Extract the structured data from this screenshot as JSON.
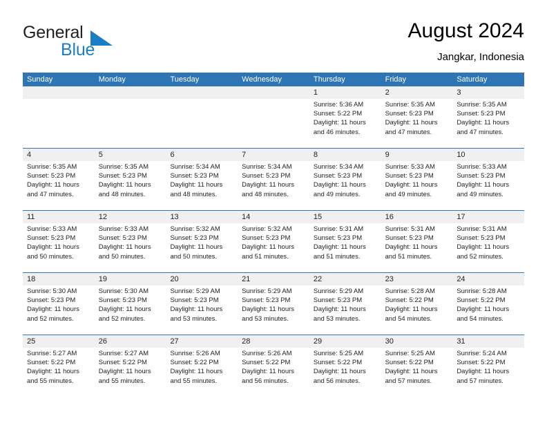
{
  "brand": {
    "name_part1": "General",
    "name_part2": "Blue",
    "triangle_color": "#1b7ec2",
    "text_color": "#231f20"
  },
  "header": {
    "title": "August 2024",
    "location": "Jangkar, Indonesia"
  },
  "theme": {
    "header_bar_color": "#2e75b6",
    "daynum_band_color": "#f0f0f0",
    "text_color": "#222222"
  },
  "weekdays": [
    "Sunday",
    "Monday",
    "Tuesday",
    "Wednesday",
    "Thursday",
    "Friday",
    "Saturday"
  ],
  "weeks": [
    {
      "daynums": [
        "",
        "",
        "",
        "",
        "1",
        "2",
        "3"
      ],
      "cells": [
        {
          "empty": true,
          "lines": [
            "",
            "",
            "",
            ""
          ]
        },
        {
          "empty": true,
          "lines": [
            "",
            "",
            "",
            ""
          ]
        },
        {
          "empty": true,
          "lines": [
            "",
            "",
            "",
            ""
          ]
        },
        {
          "empty": true,
          "lines": [
            "",
            "",
            "",
            ""
          ]
        },
        {
          "empty": false,
          "lines": [
            "Sunrise: 5:36 AM",
            "Sunset: 5:22 PM",
            "Daylight: 11 hours",
            "and 46 minutes."
          ]
        },
        {
          "empty": false,
          "lines": [
            "Sunrise: 5:35 AM",
            "Sunset: 5:23 PM",
            "Daylight: 11 hours",
            "and 47 minutes."
          ]
        },
        {
          "empty": false,
          "lines": [
            "Sunrise: 5:35 AM",
            "Sunset: 5:23 PM",
            "Daylight: 11 hours",
            "and 47 minutes."
          ]
        }
      ]
    },
    {
      "daynums": [
        "4",
        "5",
        "6",
        "7",
        "8",
        "9",
        "10"
      ],
      "cells": [
        {
          "empty": false,
          "lines": [
            "Sunrise: 5:35 AM",
            "Sunset: 5:23 PM",
            "Daylight: 11 hours",
            "and 47 minutes."
          ]
        },
        {
          "empty": false,
          "lines": [
            "Sunrise: 5:35 AM",
            "Sunset: 5:23 PM",
            "Daylight: 11 hours",
            "and 48 minutes."
          ]
        },
        {
          "empty": false,
          "lines": [
            "Sunrise: 5:34 AM",
            "Sunset: 5:23 PM",
            "Daylight: 11 hours",
            "and 48 minutes."
          ]
        },
        {
          "empty": false,
          "lines": [
            "Sunrise: 5:34 AM",
            "Sunset: 5:23 PM",
            "Daylight: 11 hours",
            "and 48 minutes."
          ]
        },
        {
          "empty": false,
          "lines": [
            "Sunrise: 5:34 AM",
            "Sunset: 5:23 PM",
            "Daylight: 11 hours",
            "and 49 minutes."
          ]
        },
        {
          "empty": false,
          "lines": [
            "Sunrise: 5:33 AM",
            "Sunset: 5:23 PM",
            "Daylight: 11 hours",
            "and 49 minutes."
          ]
        },
        {
          "empty": false,
          "lines": [
            "Sunrise: 5:33 AM",
            "Sunset: 5:23 PM",
            "Daylight: 11 hours",
            "and 49 minutes."
          ]
        }
      ]
    },
    {
      "daynums": [
        "11",
        "12",
        "13",
        "14",
        "15",
        "16",
        "17"
      ],
      "cells": [
        {
          "empty": false,
          "lines": [
            "Sunrise: 5:33 AM",
            "Sunset: 5:23 PM",
            "Daylight: 11 hours",
            "and 50 minutes."
          ]
        },
        {
          "empty": false,
          "lines": [
            "Sunrise: 5:33 AM",
            "Sunset: 5:23 PM",
            "Daylight: 11 hours",
            "and 50 minutes."
          ]
        },
        {
          "empty": false,
          "lines": [
            "Sunrise: 5:32 AM",
            "Sunset: 5:23 PM",
            "Daylight: 11 hours",
            "and 50 minutes."
          ]
        },
        {
          "empty": false,
          "lines": [
            "Sunrise: 5:32 AM",
            "Sunset: 5:23 PM",
            "Daylight: 11 hours",
            "and 51 minutes."
          ]
        },
        {
          "empty": false,
          "lines": [
            "Sunrise: 5:31 AM",
            "Sunset: 5:23 PM",
            "Daylight: 11 hours",
            "and 51 minutes."
          ]
        },
        {
          "empty": false,
          "lines": [
            "Sunrise: 5:31 AM",
            "Sunset: 5:23 PM",
            "Daylight: 11 hours",
            "and 51 minutes."
          ]
        },
        {
          "empty": false,
          "lines": [
            "Sunrise: 5:31 AM",
            "Sunset: 5:23 PM",
            "Daylight: 11 hours",
            "and 52 minutes."
          ]
        }
      ]
    },
    {
      "daynums": [
        "18",
        "19",
        "20",
        "21",
        "22",
        "23",
        "24"
      ],
      "cells": [
        {
          "empty": false,
          "lines": [
            "Sunrise: 5:30 AM",
            "Sunset: 5:23 PM",
            "Daylight: 11 hours",
            "and 52 minutes."
          ]
        },
        {
          "empty": false,
          "lines": [
            "Sunrise: 5:30 AM",
            "Sunset: 5:23 PM",
            "Daylight: 11 hours",
            "and 52 minutes."
          ]
        },
        {
          "empty": false,
          "lines": [
            "Sunrise: 5:29 AM",
            "Sunset: 5:23 PM",
            "Daylight: 11 hours",
            "and 53 minutes."
          ]
        },
        {
          "empty": false,
          "lines": [
            "Sunrise: 5:29 AM",
            "Sunset: 5:23 PM",
            "Daylight: 11 hours",
            "and 53 minutes."
          ]
        },
        {
          "empty": false,
          "lines": [
            "Sunrise: 5:29 AM",
            "Sunset: 5:23 PM",
            "Daylight: 11 hours",
            "and 53 minutes."
          ]
        },
        {
          "empty": false,
          "lines": [
            "Sunrise: 5:28 AM",
            "Sunset: 5:22 PM",
            "Daylight: 11 hours",
            "and 54 minutes."
          ]
        },
        {
          "empty": false,
          "lines": [
            "Sunrise: 5:28 AM",
            "Sunset: 5:22 PM",
            "Daylight: 11 hours",
            "and 54 minutes."
          ]
        }
      ]
    },
    {
      "daynums": [
        "25",
        "26",
        "27",
        "28",
        "29",
        "30",
        "31"
      ],
      "cells": [
        {
          "empty": false,
          "lines": [
            "Sunrise: 5:27 AM",
            "Sunset: 5:22 PM",
            "Daylight: 11 hours",
            "and 55 minutes."
          ]
        },
        {
          "empty": false,
          "lines": [
            "Sunrise: 5:27 AM",
            "Sunset: 5:22 PM",
            "Daylight: 11 hours",
            "and 55 minutes."
          ]
        },
        {
          "empty": false,
          "lines": [
            "Sunrise: 5:26 AM",
            "Sunset: 5:22 PM",
            "Daylight: 11 hours",
            "and 55 minutes."
          ]
        },
        {
          "empty": false,
          "lines": [
            "Sunrise: 5:26 AM",
            "Sunset: 5:22 PM",
            "Daylight: 11 hours",
            "and 56 minutes."
          ]
        },
        {
          "empty": false,
          "lines": [
            "Sunrise: 5:25 AM",
            "Sunset: 5:22 PM",
            "Daylight: 11 hours",
            "and 56 minutes."
          ]
        },
        {
          "empty": false,
          "lines": [
            "Sunrise: 5:25 AM",
            "Sunset: 5:22 PM",
            "Daylight: 11 hours",
            "and 57 minutes."
          ]
        },
        {
          "empty": false,
          "lines": [
            "Sunrise: 5:24 AM",
            "Sunset: 5:22 PM",
            "Daylight: 11 hours",
            "and 57 minutes."
          ]
        }
      ]
    }
  ]
}
